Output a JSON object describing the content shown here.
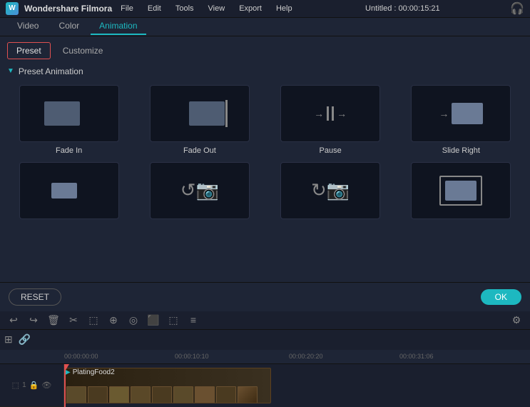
{
  "titlebar": {
    "app_name": "Wondershare Filmora",
    "menu_items": [
      "File",
      "Edit",
      "Tools",
      "View",
      "Export",
      "Help"
    ],
    "title": "Untitled : 00:00:15:21"
  },
  "tabs": {
    "items": [
      "Video",
      "Color",
      "Animation"
    ],
    "active": "Animation"
  },
  "subtabs": {
    "items": [
      "Preset",
      "Customize"
    ],
    "active": "Preset"
  },
  "preset_animation": {
    "label": "Preset Animation",
    "animations_row1": [
      {
        "id": "fade-in",
        "label": "Fade In"
      },
      {
        "id": "fade-out",
        "label": "Fade Out"
      },
      {
        "id": "pause",
        "label": "Pause"
      },
      {
        "id": "slide-right",
        "label": "Slide Right"
      }
    ],
    "animations_row2": [
      {
        "id": "anim5",
        "label": ""
      },
      {
        "id": "anim6",
        "label": ""
      },
      {
        "id": "anim7",
        "label": ""
      },
      {
        "id": "anim8",
        "label": ""
      }
    ]
  },
  "buttons": {
    "reset": "RESET",
    "ok": "OK"
  },
  "toolbar": {
    "icons": [
      "↩",
      "↪",
      "🗑",
      "✂",
      "⬚",
      "⊕",
      "◎",
      "⬛",
      "⬚",
      "≡"
    ],
    "right_icon": "⚙"
  },
  "timeline": {
    "times": [
      "00:00:00:00",
      "00:00:10:10",
      "00:00:20:20",
      "00:00:31:06"
    ],
    "clip_title": "PlatingFood2",
    "playhead_pos": "0px"
  }
}
